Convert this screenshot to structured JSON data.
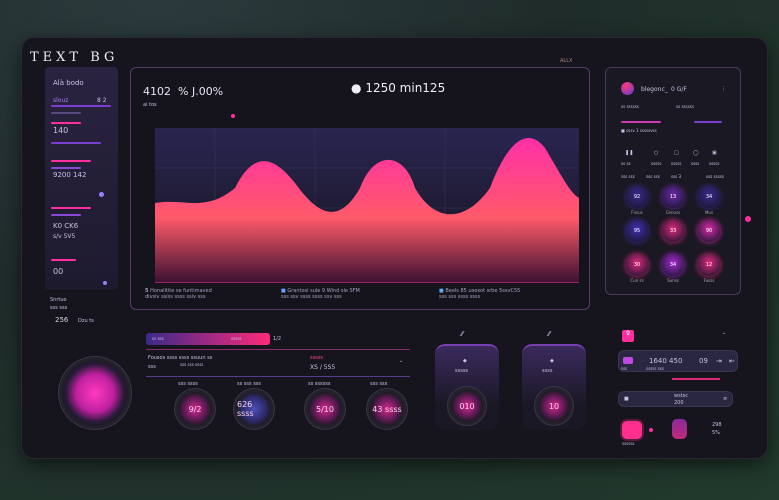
{
  "app": {
    "title": "TEXT BG",
    "top_label": "ALLX"
  },
  "sidebar": {
    "header": "Alà bodo",
    "items": [
      {
        "label": "slouz",
        "value": "8 2"
      },
      {
        "label": "ss ss"
      },
      {
        "label": "140"
      },
      {
        "label": "sv ssv"
      },
      {
        "label": "9200 142"
      },
      {
        "label": "sv ssv"
      },
      {
        "label": "K0 CK6"
      },
      {
        "label": "s/v 5V5"
      },
      {
        "label": "00"
      }
    ],
    "footer_label": "Snrtuo",
    "footer_sub": "sss sss",
    "footer_value": "256",
    "footer_unit": "Dzu ts"
  },
  "chart": {
    "value_left": "4102",
    "value_pct": "% J.00%",
    "sub_left": "ai tos",
    "value_center": "1250 min125",
    "legend": [
      {
        "icon": "5",
        "title": "Honailtite se funtimaved",
        "sub": "divsiv ssiss ssss ssiv sss"
      },
      {
        "icon": "■",
        "title": "Grantosl sule 9 Wind sle SFM",
        "sub": "sss ssv ssss ssss ssv sss"
      },
      {
        "icon": "■",
        "title": "Beels 85 usexot srbe 5ssvC55",
        "sub": "sss sss ssss ssss"
      }
    ]
  },
  "right_panel": {
    "user": "blegonc_",
    "status": "0 G/F",
    "sub1": "ss ssssss",
    "sub2": "ss ssssss",
    "check_label": "sssv 1 sssssvss",
    "controls": [
      {
        "icon": "pause-icon",
        "label": "ss ss"
      },
      {
        "icon": "circle-icon",
        "label": "sssss"
      },
      {
        "icon": "square-icon",
        "label": "sssss"
      },
      {
        "icon": "record-icon",
        "label": "ssss"
      },
      {
        "icon": "window-icon",
        "label": "sssss"
      }
    ],
    "row_labels": [
      "sss sss",
      "sss sss",
      "sss 3",
      "sss sssss"
    ],
    "pads": [
      {
        "label": "92",
        "name": "Fnsus",
        "color": "#3b2a8c"
      },
      {
        "label": "13",
        "name": "Cenuss",
        "color": "#6a2aa8"
      },
      {
        "label": "34",
        "name": "Mus",
        "color": "#3b2a8c"
      },
      {
        "label": "95",
        "name": "",
        "color": "#4030b0"
      },
      {
        "label": "33",
        "name": "",
        "color": "#e0287e"
      },
      {
        "label": "90",
        "name": "",
        "color": "#d82aa8"
      },
      {
        "label": "30",
        "name": "Cun ss",
        "color": "#e0287e"
      },
      {
        "label": "34",
        "name": "Sunss",
        "color": "#a52ad0"
      },
      {
        "label": "12",
        "name": "Fusss",
        "color": "#e0287e"
      }
    ]
  },
  "controls": {
    "strip_left": "ss sss",
    "strip_right": "sssss",
    "strip_value": "1/2",
    "row_title": "Fousos ssss ssss ssuun ss",
    "row_sub": "sss sss ssss",
    "row_tag": "sssss",
    "row_value": "XS / 5S5",
    "row_left": "sss",
    "knobs": [
      {
        "top": "sss ssss",
        "label": "9/2",
        "style": "pink"
      },
      {
        "top": "ss sss  sss",
        "label": "626 ssss",
        "style": "blue"
      },
      {
        "top": "ss ssssss",
        "label": "5/10",
        "style": "pink"
      },
      {
        "top": "sss  sss",
        "label": "43 ssss",
        "style": "pink"
      }
    ],
    "cards": [
      {
        "icon_label": "⁄⁄",
        "title": "sssss",
        "value": "010"
      },
      {
        "icon_label": "⁄⁄",
        "title": "ssss",
        "value": "10"
      }
    ]
  },
  "bottom_right": {
    "tag": "9",
    "item_value": "1640 450",
    "item_num": "09",
    "item_sub": "sssss sss",
    "item_label": "sss",
    "field_title": "wstsc",
    "field_value": "200",
    "stat1": "298",
    "stat2": "5%",
    "btn_label": "ssssss"
  },
  "colors": {
    "accent": "#ff2fa0",
    "purple": "#7a3fd0",
    "bg": "#16141d"
  }
}
